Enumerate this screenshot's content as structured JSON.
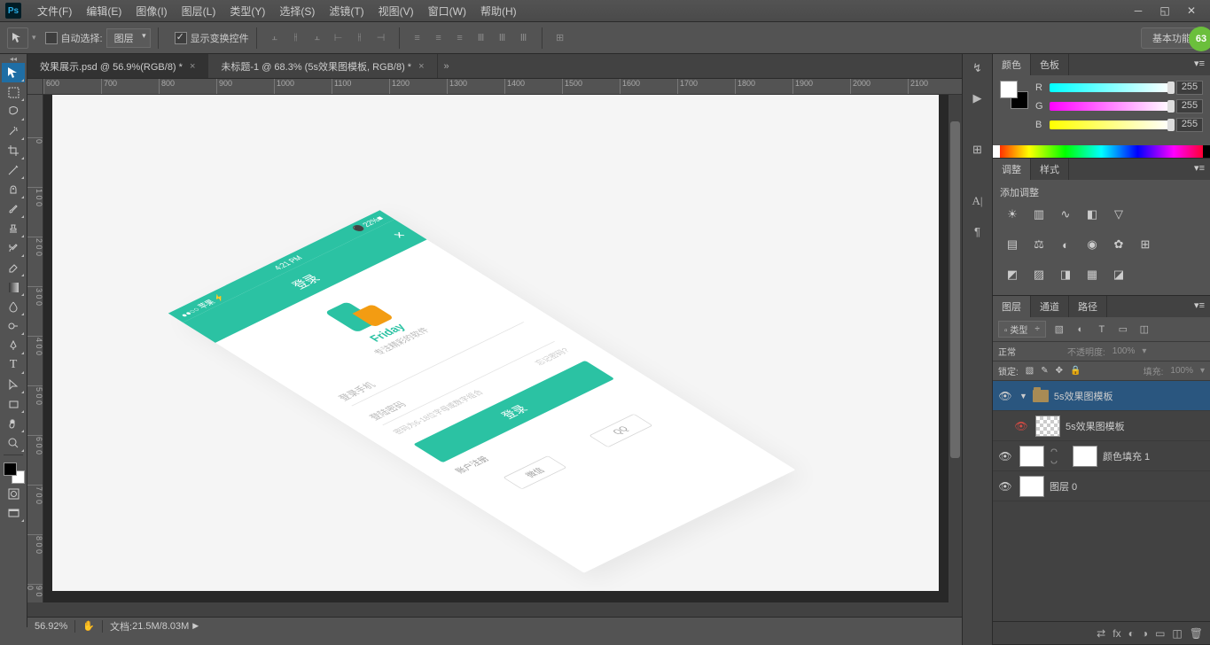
{
  "menu": {
    "items": [
      "文件(F)",
      "编辑(E)",
      "图像(I)",
      "图层(L)",
      "类型(Y)",
      "选择(S)",
      "滤镜(T)",
      "视图(V)",
      "窗口(W)",
      "帮助(H)"
    ]
  },
  "optbar": {
    "auto_select": "自动选择:",
    "auto_dd": "图层",
    "show_transform": "显示变换控件",
    "basic_btn": "基本功能",
    "badge": "63"
  },
  "tabs": [
    {
      "label": "效果展示.psd @ 56.9%(RGB/8) *",
      "active": true
    },
    {
      "label": "未标题-1 @ 68.3% (5s效果图模板, RGB/8) *",
      "active": false
    }
  ],
  "ruler_h": [
    600,
    700,
    800,
    900,
    1000,
    1100,
    1200,
    1300,
    1400,
    1500,
    1600,
    1700,
    1800,
    1900,
    2000,
    2100
  ],
  "ruler_v": [
    "0",
    "0",
    "1 0 0",
    "2 0 0",
    "3 0 0",
    "4 0 0",
    "5 0 0",
    "6 0 0",
    "7 0 0",
    "8 0 0",
    "9 0 0"
  ],
  "mockup": {
    "status_left": "●●○○ 苹果  ⚡",
    "status_time": "4:21 PM",
    "status_right": "⚫ 22%■",
    "header": "登录",
    "brand": "Friday",
    "slogan": "专注精彩的软件",
    "field1": "登录手机",
    "field2": "登陆密码",
    "hint_left": "密码为6-18位字母或数字组合",
    "hint_right": "忘记密码?",
    "login_btn": "登录",
    "link_left": "账户注册",
    "social1": "微信",
    "social2": "QQ"
  },
  "status": {
    "zoom": "56.92%",
    "doc_label": "文档:",
    "doc_val": "21.5M/8.03M"
  },
  "color_panel": {
    "tab1": "颜色",
    "tab2": "色板",
    "r": "R",
    "g": "G",
    "b": "B",
    "rv": "255",
    "gv": "255",
    "bv": "255"
  },
  "adjust_panel": {
    "tab1": "调整",
    "tab2": "样式",
    "title": "添加调整"
  },
  "layers_panel": {
    "tab1": "图层",
    "tab2": "通道",
    "tab3": "路径",
    "kind": "▫ 类型",
    "blend": "正常",
    "opacity_lab": "不透明度:",
    "opacity_val": "100%",
    "lock_lab": "锁定:",
    "fill_lab": "填充:",
    "fill_val": "100%",
    "rows": [
      {
        "type": "group",
        "name": "5s效果图模板",
        "sel": true,
        "eye": "normal"
      },
      {
        "type": "smart",
        "name": "5s效果图模板",
        "sel": false,
        "eye": "red",
        "indent": true
      },
      {
        "type": "fill",
        "name": "颜色填充 1",
        "sel": false,
        "eye": "normal"
      },
      {
        "type": "bg",
        "name": "图层 0",
        "sel": false,
        "eye": "normal"
      }
    ]
  }
}
